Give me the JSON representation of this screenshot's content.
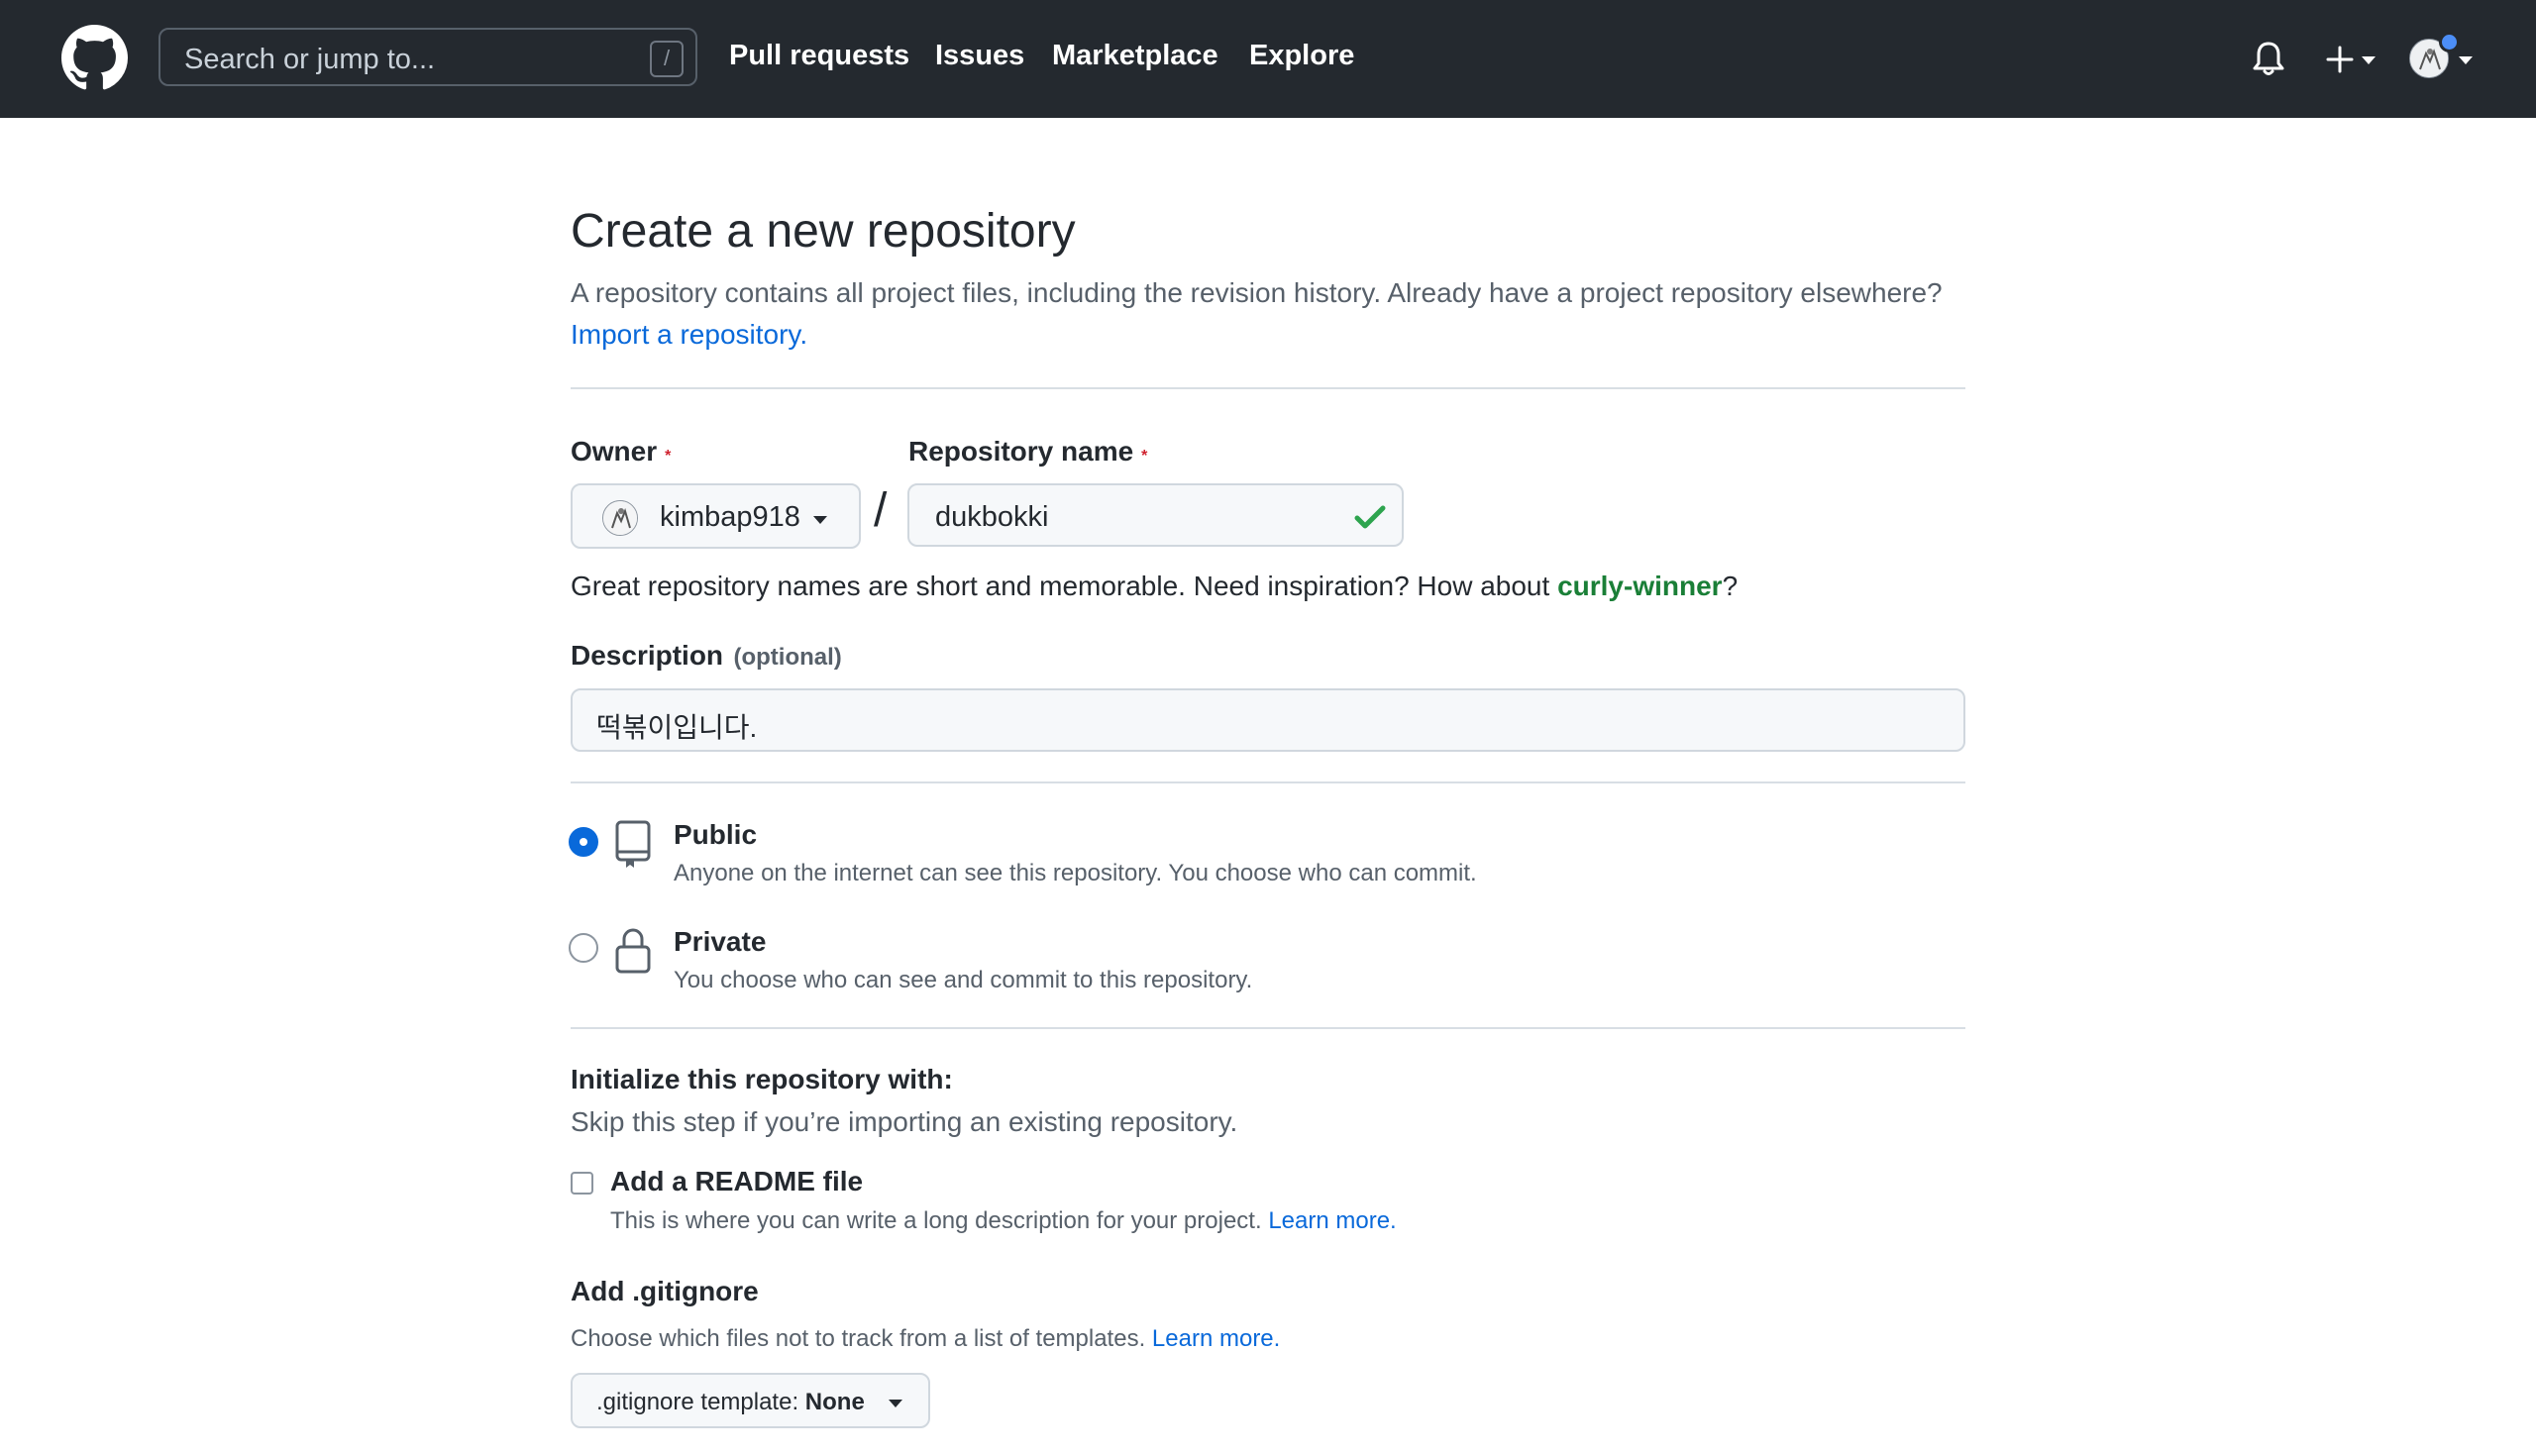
{
  "header": {
    "search_placeholder": "Search or jump to...",
    "search_shortcut": "/",
    "nav": [
      "Pull requests",
      "Issues",
      "Marketplace",
      "Explore"
    ]
  },
  "page": {
    "title": "Create a new repository",
    "subtitle_prefix": "A repository contains all project files, including the revision history. Already have a project repository elsewhere?",
    "import_link": "Import a repository."
  },
  "owner": {
    "label": "Owner",
    "required_mark": "*",
    "value": "kimbap918"
  },
  "repo_name": {
    "label": "Repository name",
    "required_mark": "*",
    "value": "dukbokki",
    "separator": "/"
  },
  "name_hint": {
    "prefix": "Great repository names are short and memorable. Need inspiration? How about",
    "suggestion": "curly-winner",
    "suffix": "?"
  },
  "description": {
    "label": "Description",
    "optional": "(optional)",
    "value": "떡볶이입니다."
  },
  "visibility": {
    "selected": "public",
    "public_title": "Public",
    "public_desc": "Anyone on the internet can see this repository. You choose who can commit.",
    "private_title": "Private",
    "private_desc": "You choose who can see and commit to this repository."
  },
  "init": {
    "title": "Initialize this repository with:",
    "subtitle": "Skip this step if you’re importing an existing repository.",
    "readme_title": "Add a README file",
    "readme_desc": "This is where you can write a long description for your project.",
    "readme_link": "Learn more.",
    "readme_checked": false
  },
  "gitignore": {
    "title": "Add .gitignore",
    "desc": "Choose which files not to track from a list of templates.",
    "link": "Learn more.",
    "button_prefix": ".gitignore template:",
    "button_value": "None"
  },
  "colors": {
    "header_bg": "#24292f",
    "link": "#0969da",
    "required": "#cf222e",
    "success": "#1a7f37",
    "radio_selected": "#0969da"
  }
}
